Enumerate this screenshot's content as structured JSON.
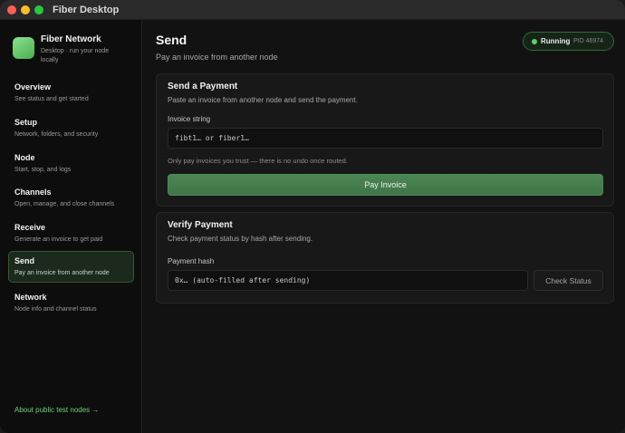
{
  "window": {
    "title": "Fiber Desktop"
  },
  "brand": {
    "name": "Fiber Network",
    "subtitle": "Desktop · run your node locally"
  },
  "sidebar": {
    "items": [
      {
        "title": "Overview",
        "desc": "See status and get started"
      },
      {
        "title": "Setup",
        "desc": "Network, folders, and security"
      },
      {
        "title": "Node",
        "desc": "Start, stop, and logs"
      },
      {
        "title": "Channels",
        "desc": "Open, manage, and close channels"
      },
      {
        "title": "Receive",
        "desc": "Generate an invoice to get paid"
      },
      {
        "title": "Send",
        "desc": "Pay an invoice from another node"
      },
      {
        "title": "Network",
        "desc": "Node info and channel status"
      }
    ],
    "active": "Send",
    "about_link": "About public test nodes →"
  },
  "header": {
    "title": "Send",
    "subtitle": "Pay an invoice from another node"
  },
  "status": {
    "label": "Running",
    "pid": "PID 46974",
    "color": "#5ad269"
  },
  "send_card": {
    "title": "Send a Payment",
    "desc": "Paste an invoice from another node and send the payment.",
    "field_label": "Invoice string",
    "placeholder": "fibt1… or fiber1…",
    "value": "",
    "hint": "Only pay invoices you trust — there is no undo once routed.",
    "button": "Pay Invoice"
  },
  "verify_card": {
    "title": "Verify Payment",
    "desc": "Check payment status by hash after sending.",
    "field_label": "Payment hash",
    "placeholder": "0x… (auto-filled after sending)",
    "value": "",
    "button": "Check Status"
  },
  "colors": {
    "accent": "#4c8654",
    "accent_text": "#6fd17a",
    "background": "#121212"
  }
}
